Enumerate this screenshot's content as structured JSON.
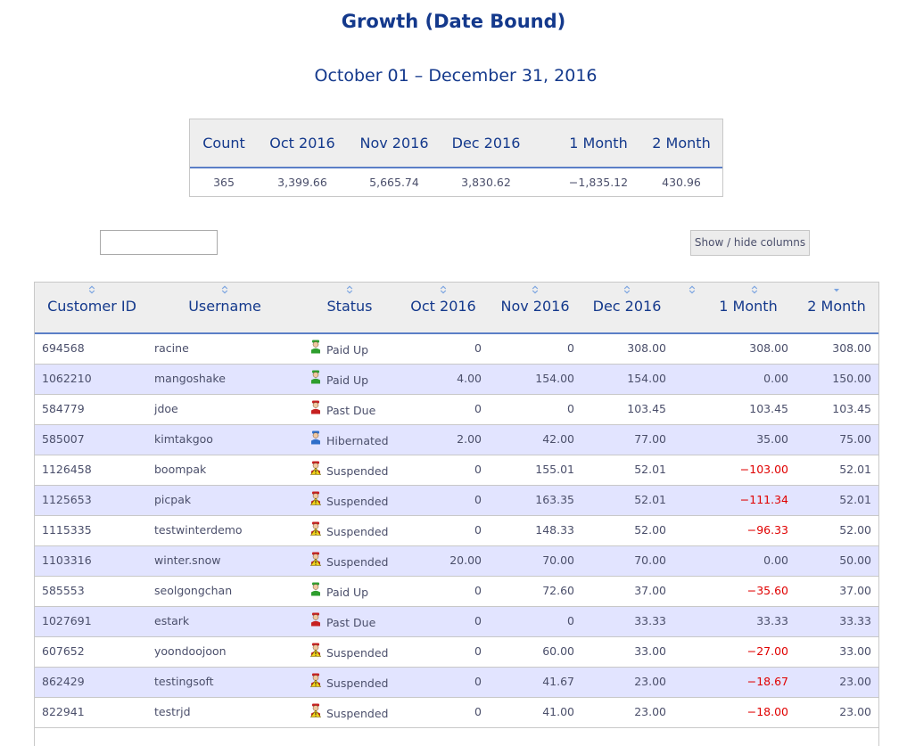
{
  "page": {
    "title": "Growth (Date Bound)",
    "date_range": "October 01 – December 31, 2016"
  },
  "summary": {
    "headers": [
      "Count",
      "Oct 2016",
      "Nov 2016",
      "Dec 2016",
      "1 Month",
      "2 Month"
    ],
    "values": [
      "365",
      "3,399.66",
      "5,665.74",
      "3,830.62",
      "−1,835.12",
      "430.96"
    ]
  },
  "search": {
    "value": "",
    "placeholder": ""
  },
  "toolbar": {
    "colvis_label": "Show / hide columns"
  },
  "table": {
    "headers": [
      "Customer ID",
      "Username",
      "Status",
      "Oct 2016",
      "Nov 2016",
      "Dec 2016",
      "",
      "1 Month",
      "2 Month"
    ],
    "rows": [
      {
        "id": "694568",
        "username": "racine",
        "status": "Paid Up",
        "status_kind": "paid",
        "oct": "0",
        "nov": "0",
        "dec": "308.00",
        "m1": "308.00",
        "m1_neg": false,
        "m2": "308.00"
      },
      {
        "id": "1062210",
        "username": "mangoshake",
        "status": "Paid Up",
        "status_kind": "paid",
        "oct": "4.00",
        "nov": "154.00",
        "dec": "154.00",
        "m1": "0.00",
        "m1_neg": false,
        "m2": "150.00"
      },
      {
        "id": "584779",
        "username": "jdoe",
        "status": "Past Due",
        "status_kind": "pastdue",
        "oct": "0",
        "nov": "0",
        "dec": "103.45",
        "m1": "103.45",
        "m1_neg": false,
        "m2": "103.45"
      },
      {
        "id": "585007",
        "username": "kimtakgoo",
        "status": "Hibernated",
        "status_kind": "hibernated",
        "oct": "2.00",
        "nov": "42.00",
        "dec": "77.00",
        "m1": "35.00",
        "m1_neg": false,
        "m2": "75.00"
      },
      {
        "id": "1126458",
        "username": "boompak",
        "status": "Suspended",
        "status_kind": "suspended",
        "oct": "0",
        "nov": "155.01",
        "dec": "52.01",
        "m1": "−103.00",
        "m1_neg": true,
        "m2": "52.01"
      },
      {
        "id": "1125653",
        "username": "picpak",
        "status": "Suspended",
        "status_kind": "suspended",
        "oct": "0",
        "nov": "163.35",
        "dec": "52.01",
        "m1": "−111.34",
        "m1_neg": true,
        "m2": "52.01"
      },
      {
        "id": "1115335",
        "username": "testwinterdemo",
        "status": "Suspended",
        "status_kind": "suspended",
        "oct": "0",
        "nov": "148.33",
        "dec": "52.00",
        "m1": "−96.33",
        "m1_neg": true,
        "m2": "52.00"
      },
      {
        "id": "1103316",
        "username": "winter.snow",
        "status": "Suspended",
        "status_kind": "suspended",
        "oct": "20.00",
        "nov": "70.00",
        "dec": "70.00",
        "m1": "0.00",
        "m1_neg": false,
        "m2": "50.00"
      },
      {
        "id": "585553",
        "username": "seolgongchan",
        "status": "Paid Up",
        "status_kind": "paid",
        "oct": "0",
        "nov": "72.60",
        "dec": "37.00",
        "m1": "−35.60",
        "m1_neg": true,
        "m2": "37.00"
      },
      {
        "id": "1027691",
        "username": "estark",
        "status": "Past Due",
        "status_kind": "pastdue",
        "oct": "0",
        "nov": "0",
        "dec": "33.33",
        "m1": "33.33",
        "m1_neg": false,
        "m2": "33.33"
      },
      {
        "id": "607652",
        "username": "yoondoojoon",
        "status": "Suspended",
        "status_kind": "suspended",
        "oct": "0",
        "nov": "60.00",
        "dec": "33.00",
        "m1": "−27.00",
        "m1_neg": true,
        "m2": "33.00"
      },
      {
        "id": "862429",
        "username": "testingsoft",
        "status": "Suspended",
        "status_kind": "suspended",
        "oct": "0",
        "nov": "41.67",
        "dec": "23.00",
        "m1": "−18.67",
        "m1_neg": true,
        "m2": "23.00"
      },
      {
        "id": "822941",
        "username": "testrjd",
        "status": "Suspended",
        "status_kind": "suspended",
        "oct": "0",
        "nov": "41.00",
        "dec": "23.00",
        "m1": "−18.00",
        "m1_neg": true,
        "m2": "23.00"
      }
    ]
  },
  "status_colors": {
    "paid": "#2e9e2e",
    "pastdue": "#c62020",
    "hibernated": "#2f6fc9",
    "suspended": "#c62020",
    "warning": "#f2d21b"
  },
  "accent": {
    "title": "#14398c",
    "negative": "#e00000",
    "stripe": "#e2e4ff"
  }
}
